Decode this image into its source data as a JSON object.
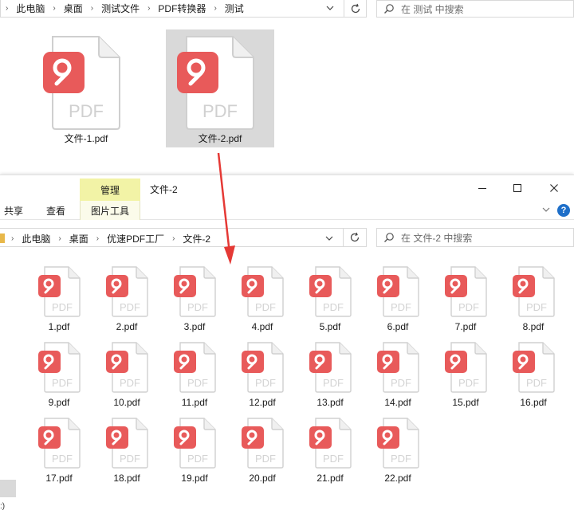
{
  "top_window": {
    "breadcrumb": [
      "此电脑",
      "桌面",
      "测试文件",
      "PDF转换器",
      "测试"
    ],
    "search_placeholder": "在 测试 中搜索",
    "files": [
      {
        "name": "文件-1.pdf",
        "selected": false
      },
      {
        "name": "文件-2.pdf",
        "selected": true
      }
    ]
  },
  "bottom_window": {
    "manage_tab": "管理",
    "title": "文件-2",
    "ribbon_tabs": [
      "共享",
      "查看"
    ],
    "picture_tools_tab": "图片工具",
    "help_label": "?",
    "breadcrumb": [
      "此电脑",
      "桌面",
      "优速PDF工厂",
      "文件-2"
    ],
    "search_placeholder": "在 文件-2 中搜索",
    "left_pane_fragment": ":)",
    "files": [
      "1.pdf",
      "2.pdf",
      "3.pdf",
      "4.pdf",
      "5.pdf",
      "6.pdf",
      "7.pdf",
      "8.pdf",
      "9.pdf",
      "10.pdf",
      "11.pdf",
      "12.pdf",
      "13.pdf",
      "14.pdf",
      "15.pdf",
      "16.pdf",
      "17.pdf",
      "18.pdf",
      "19.pdf",
      "20.pdf",
      "21.pdf",
      "22.pdf"
    ]
  },
  "icons": {
    "pdf_badge_label": "PDF",
    "file_icon": "pdf-file-icon",
    "badge_color": "#e85a5a",
    "arrow_color": "#e53935"
  }
}
